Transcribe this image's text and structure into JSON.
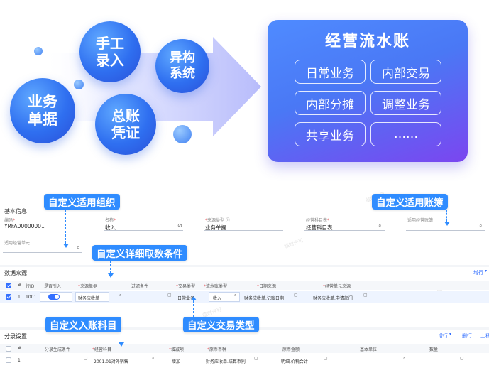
{
  "infographic": {
    "sources": [
      "业务单据",
      "手工录入",
      "异构系统",
      "总账凭证"
    ],
    "source_lines": {
      "yewu": [
        "业务",
        "单据"
      ],
      "shougong": [
        "手工",
        "录入"
      ],
      "yigou": [
        "异构",
        "系统"
      ],
      "zongzhang": [
        "总账",
        "凭证"
      ]
    },
    "panel_title": "经营流水账",
    "tags": [
      "日常业务",
      "内部交易",
      "内部分摊",
      "调整业务",
      "共享业务",
      "……"
    ]
  },
  "callouts": {
    "org": "自定义适用组织",
    "ledger": "自定义适用账簿",
    "condition": "自定义详细取数条件",
    "account": "自定义入账科目",
    "trade": "自定义交易类型"
  },
  "basic_info": {
    "title": "基本信息",
    "code_label": "编码",
    "code_value": "YRFA00000001",
    "name_label": "名称",
    "name_value": "收入",
    "source_type_label": "来源类型",
    "source_type_value": "业务单据",
    "chart_label": "经营科目表",
    "chart_value": "经营科目表",
    "ledger_label": "适用经营账簿",
    "unit_label": "适用经营单元"
  },
  "data_source": {
    "title": "数据来源",
    "add_row": "增行",
    "columns": [
      "#",
      "行ID",
      "是否引入",
      "来源单据",
      "过滤条件",
      "交易类型",
      "流水账类型",
      "日期来源",
      "经营单元来源"
    ],
    "row": {
      "index": "1",
      "row_id": "1001",
      "source_doc": "财务应收单",
      "trade_type": "日常业务",
      "flow_type": "收入",
      "date_source": "财务应收单.记账日期",
      "unit_source": "财务应收单.申请部门"
    }
  },
  "entry_settings": {
    "title": "分录设置",
    "add_row": "增行",
    "delete_row": "删行",
    "move_up": "上移",
    "columns": [
      "#",
      "分录生成条件",
      "经营科目",
      "增减项",
      "原币币种",
      "原币金额",
      "基本单位",
      "数量"
    ],
    "row": {
      "index": "1",
      "account": "2001.01对外销售",
      "direction": "增加",
      "currency": "财务应收单.结算币别",
      "amount": "明细.价税合计"
    }
  },
  "watermark": "临时许可",
  "colors": {
    "accent": "#2f8cff",
    "panel_start": "#4f8bff",
    "panel_end": "#7b46f0",
    "bubble": "#2f6ff0"
  }
}
